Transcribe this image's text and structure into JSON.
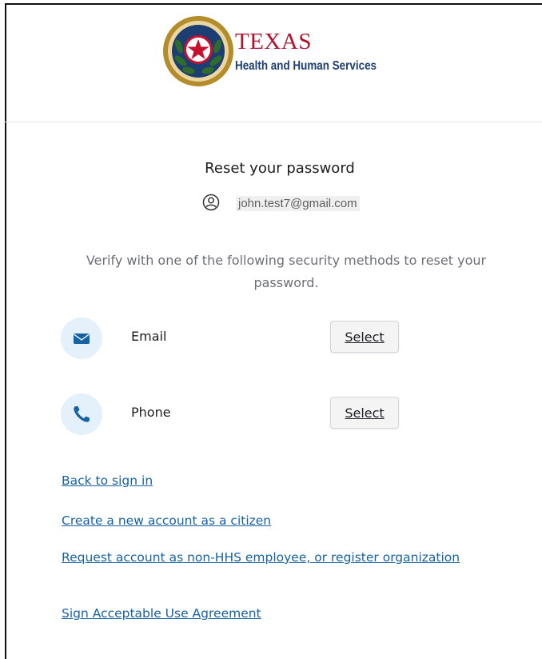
{
  "logo": {
    "title": "TEXAS",
    "subtitle": "Health and Human Services",
    "seal_icon": "texas-seal-icon"
  },
  "form": {
    "title": "Reset your password",
    "user_icon": "user-circle-icon",
    "username": "john.test7@gmail.com",
    "instructions": "Verify with one of the following security methods to reset your password."
  },
  "methods": [
    {
      "label": "Email",
      "icon": "email-icon",
      "select_label": "Select"
    },
    {
      "label": "Phone",
      "icon": "phone-icon",
      "select_label": "Select"
    }
  ],
  "links": {
    "back": "Back to sign in",
    "create": "Create a new account as a citizen",
    "request": "Request account as non-HHS employee, or register organization",
    "sign": "Sign Acceptable Use Agreement"
  },
  "colors": {
    "link": "#1662a3",
    "brand_red": "#b0122c",
    "brand_blue": "#1d3e72",
    "method_icon_bg": "#e5f1fa",
    "method_icon": "#1662a3"
  }
}
